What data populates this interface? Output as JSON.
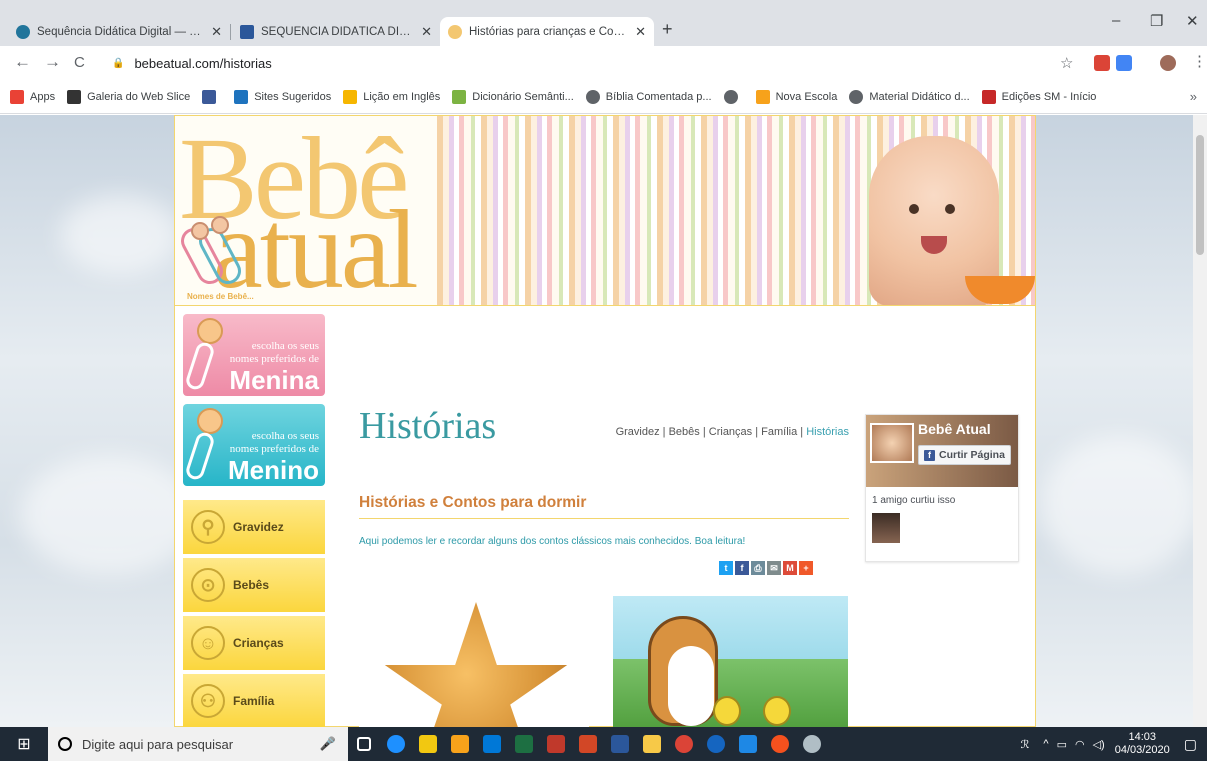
{
  "browser": {
    "tabs": [
      {
        "title": "Sequência Didática Digital — Wo",
        "icon_color": "#21759b",
        "active": false
      },
      {
        "title": "SEQUÊNCIA DIDÁTICA DIGITAL -",
        "icon_color": "#2b579a",
        "active": false
      },
      {
        "title": "Histórias para crianças e Contos",
        "icon_color": "#f3c771",
        "active": true
      }
    ],
    "new_tab": "+",
    "window": {
      "minimize": "–",
      "maximize": "❐",
      "close": "✕"
    },
    "url": "bebeatual.com/historias",
    "nav": {
      "back": "←",
      "forward": "→",
      "reload": "C"
    },
    "star": "☆",
    "menu": "⋮"
  },
  "bookmarks": {
    "items": [
      {
        "label": "Apps",
        "icon_color": "#e94235"
      },
      {
        "label": "Galeria do Web Slice",
        "icon_color": "#333333"
      },
      {
        "label": "",
        "icon_color": "#3b5998"
      },
      {
        "label": "Sites Sugeridos",
        "icon_color": "#1e73be"
      },
      {
        "label": "Lição em Inglês",
        "icon_color": "#f6b600"
      },
      {
        "label": "Dicionário Semânti...",
        "icon_color": "#7cb342"
      },
      {
        "label": "Bíblia Comentada p...",
        "icon_color": "#5f6368"
      },
      {
        "label": "",
        "icon_color": "#5f6368"
      },
      {
        "label": "Nova Escola",
        "icon_color": "#f7a21b"
      },
      {
        "label": "Material Didático d...",
        "icon_color": "#5f6368"
      },
      {
        "label": "Edições SM - Início",
        "icon_color": "#c62828"
      }
    ],
    "more": "»"
  },
  "site": {
    "logo_top": "Bebê",
    "logo_bottom": "atual",
    "logo_sub": "Nomes de Bebê...",
    "name_buttons": [
      {
        "small": "escolha os seus nomes preferidos de",
        "big": "Menina"
      },
      {
        "small": "escolha os seus nomes preferidos de",
        "big": "Menino"
      }
    ],
    "categories": [
      {
        "label": "Gravidez",
        "icon": "⚲"
      },
      {
        "label": "Bebês",
        "icon": "⊙"
      },
      {
        "label": "Crianças",
        "icon": "☺"
      },
      {
        "label": "Família",
        "icon": "⚇"
      }
    ],
    "page_title": "Histórias",
    "topnav": [
      {
        "label": "Gravidez",
        "current": false
      },
      {
        "label": "Bebês",
        "current": false
      },
      {
        "label": "Crianças",
        "current": false
      },
      {
        "label": "Família",
        "current": false
      },
      {
        "label": "Histórias",
        "current": true
      }
    ],
    "topnav_sep": "|",
    "subtitle": "Histórias e Contos para dormir",
    "intro": "Aqui podemos ler e recordar alguns dos contos clássicos mais conhecidos. Boa leitura!",
    "share": [
      {
        "icon": "twitter-icon",
        "glyph": "t",
        "color": "#1da1f2"
      },
      {
        "icon": "facebook-icon",
        "glyph": "f",
        "color": "#3b5998"
      },
      {
        "icon": "print-icon",
        "glyph": "⎙",
        "color": "#6d8b9a"
      },
      {
        "icon": "email-icon",
        "glyph": "✉",
        "color": "#7f8c8d"
      },
      {
        "icon": "gmail-icon",
        "glyph": "M",
        "color": "#dd4b39"
      },
      {
        "icon": "more-share-icon",
        "glyph": "+",
        "color": "#f0592a"
      }
    ]
  },
  "facebook": {
    "page_name": "Bebê Atual",
    "like_label": "Curtir Página",
    "like_glyph": "f",
    "friends_text": "1 amigo curtiu isso"
  },
  "taskbar": {
    "search_placeholder": "Digite aqui para pesquisar",
    "apps": [
      "#1e90ff",
      "#0078d7",
      "#f2c811",
      "#f7a21b",
      "#0078d7",
      "#1d6f42",
      "#c0392b",
      "#d24726",
      "#2b579a",
      "#f7c948",
      "#db4437",
      "#1565c0",
      "#1e88e5",
      "#f4511e",
      "#b0bec5"
    ],
    "time": "14:03",
    "date": "04/03/2020"
  }
}
